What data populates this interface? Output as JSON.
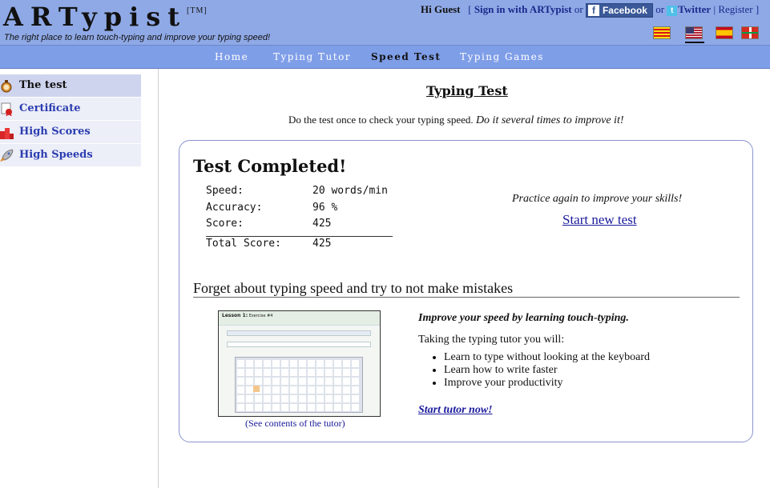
{
  "header": {
    "logo": "ARTypist",
    "trademark": "[TM]",
    "tagline": "The right place to learn touch-typing and improve your typing speed!",
    "greeting": "Hi Guest",
    "bracket_open": "[",
    "signin": "Sign in with ARTypist",
    "or1": "or",
    "facebook": "Facebook",
    "or2": "or",
    "twitter": "Twitter",
    "pipe": "|",
    "register": "Register",
    "bracket_close": "]",
    "flags": [
      "catalan-flag",
      "us-flag",
      "spain-flag",
      "basque-flag"
    ]
  },
  "nav": {
    "items": [
      "Home",
      "Typing Tutor",
      "Speed Test",
      "Typing Games"
    ],
    "active": "Speed Test"
  },
  "sidebar": {
    "items": [
      {
        "label": "The test",
        "icon": "stopwatch-icon",
        "active": true
      },
      {
        "label": "Certificate",
        "icon": "certificate-icon",
        "active": false
      },
      {
        "label": "High Scores",
        "icon": "podium-icon",
        "active": false
      },
      {
        "label": "High Speeds",
        "icon": "rocket-icon",
        "active": false
      }
    ]
  },
  "main": {
    "title": "Typing Test",
    "intro_plain": "Do the test once to check your typing speed.",
    "intro_italic": "Do it several times to improve it!",
    "result": {
      "heading": "Test Completed!",
      "speed_label": "Speed:",
      "speed_value": "20 words/min",
      "accuracy_label": "Accuracy:",
      "accuracy_value": "96 %",
      "score_label": "Score:",
      "score_value": "425",
      "total_label": "Total Score:",
      "total_value": "425",
      "practice_text": "Practice again to improve your skills!",
      "start_new": "Start new test"
    },
    "tutor": {
      "heading": "Forget about typing speed and try to not make mistakes",
      "see_contents": "(See contents of the tutor)",
      "improve": "Improve your speed by learning touch-typing.",
      "taking": "Taking the typing tutor you will:",
      "benefits": [
        "Learn to type without looking at the keyboard",
        "Learn how to write faster",
        "Improve your productivity"
      ],
      "start_tutor": "Start tutor now!",
      "thumb_lesson": "Lesson 1:",
      "thumb_exercise": "Exercise #4"
    }
  },
  "colors": {
    "header_bg": "#8fa9e6",
    "nav_bg": "#7f9ee8",
    "link": "#1a1a9c",
    "sidebar_link": "#2c3db0",
    "panel_border": "#8a94cf"
  }
}
